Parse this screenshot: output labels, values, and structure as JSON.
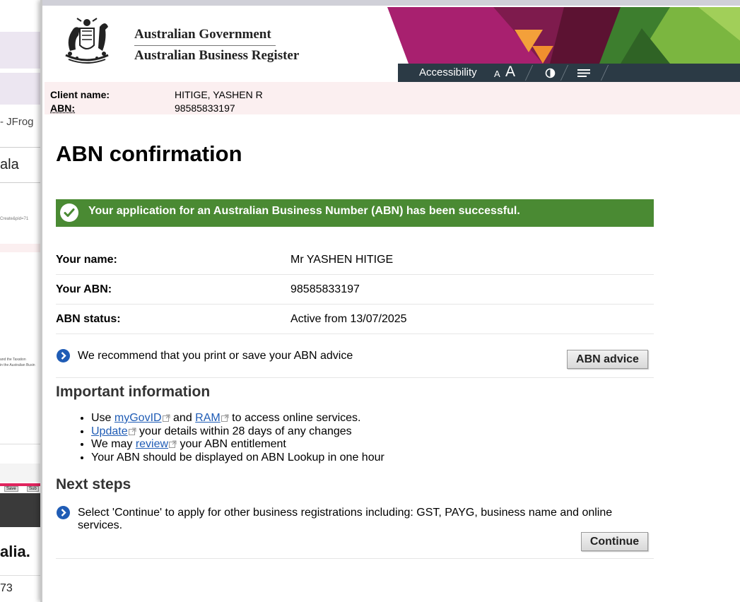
{
  "background": {
    "items": [
      " - JFrog",
      "ala",
      "Create&pid=71",
      "and the Taxation",
      "in the Australian Busin",
      "Save",
      "Sub",
      "alia.",
      "73"
    ]
  },
  "header": {
    "gov_line1": "Australian Government",
    "gov_line2": "Australian Business Register",
    "accessibility_label": "Accessibility",
    "text_size_small": "A",
    "text_size_large": "A"
  },
  "client": {
    "name_label": "Client name:",
    "name_value": "HITIGE, YASHEN R",
    "abn_label": "ABN:",
    "abn_value": "98585833197"
  },
  "page_title": "ABN confirmation",
  "success_message": "Your application for an Australian Business Number (ABN) has been successful.",
  "details": [
    {
      "label": "Your name:",
      "value": "Mr YASHEN HITIGE"
    },
    {
      "label": "Your ABN:",
      "value": "98585833197"
    },
    {
      "label": "ABN status:",
      "value": "Active from 13/07/2025"
    }
  ],
  "recommend": {
    "text": "We recommend that you print or save your ABN advice",
    "button": "ABN advice"
  },
  "important": {
    "heading": "Important information",
    "l1_pre": "Use ",
    "l1_link1": "myGovID",
    "l1_mid": " and ",
    "l1_link2": "RAM",
    "l1_post": " to access online services.",
    "l2_link": "Update",
    "l2_post": " your details within 28 days of any changes",
    "l3_pre": "We may ",
    "l3_link": "review",
    "l3_post": " your ABN entitlement",
    "l4": "Your ABN should be displayed on ABN Lookup in one hour"
  },
  "next_steps": {
    "heading": "Next steps",
    "text": "Select 'Continue' to apply for other business registrations including: GST, PAYG, business name and online services.",
    "button": "Continue"
  },
  "colors": {
    "success_green": "#4a8a33",
    "link_blue": "#1f5cb5",
    "client_bar_bg": "#fbeff0",
    "access_bar_bg": "#2b3a45"
  }
}
